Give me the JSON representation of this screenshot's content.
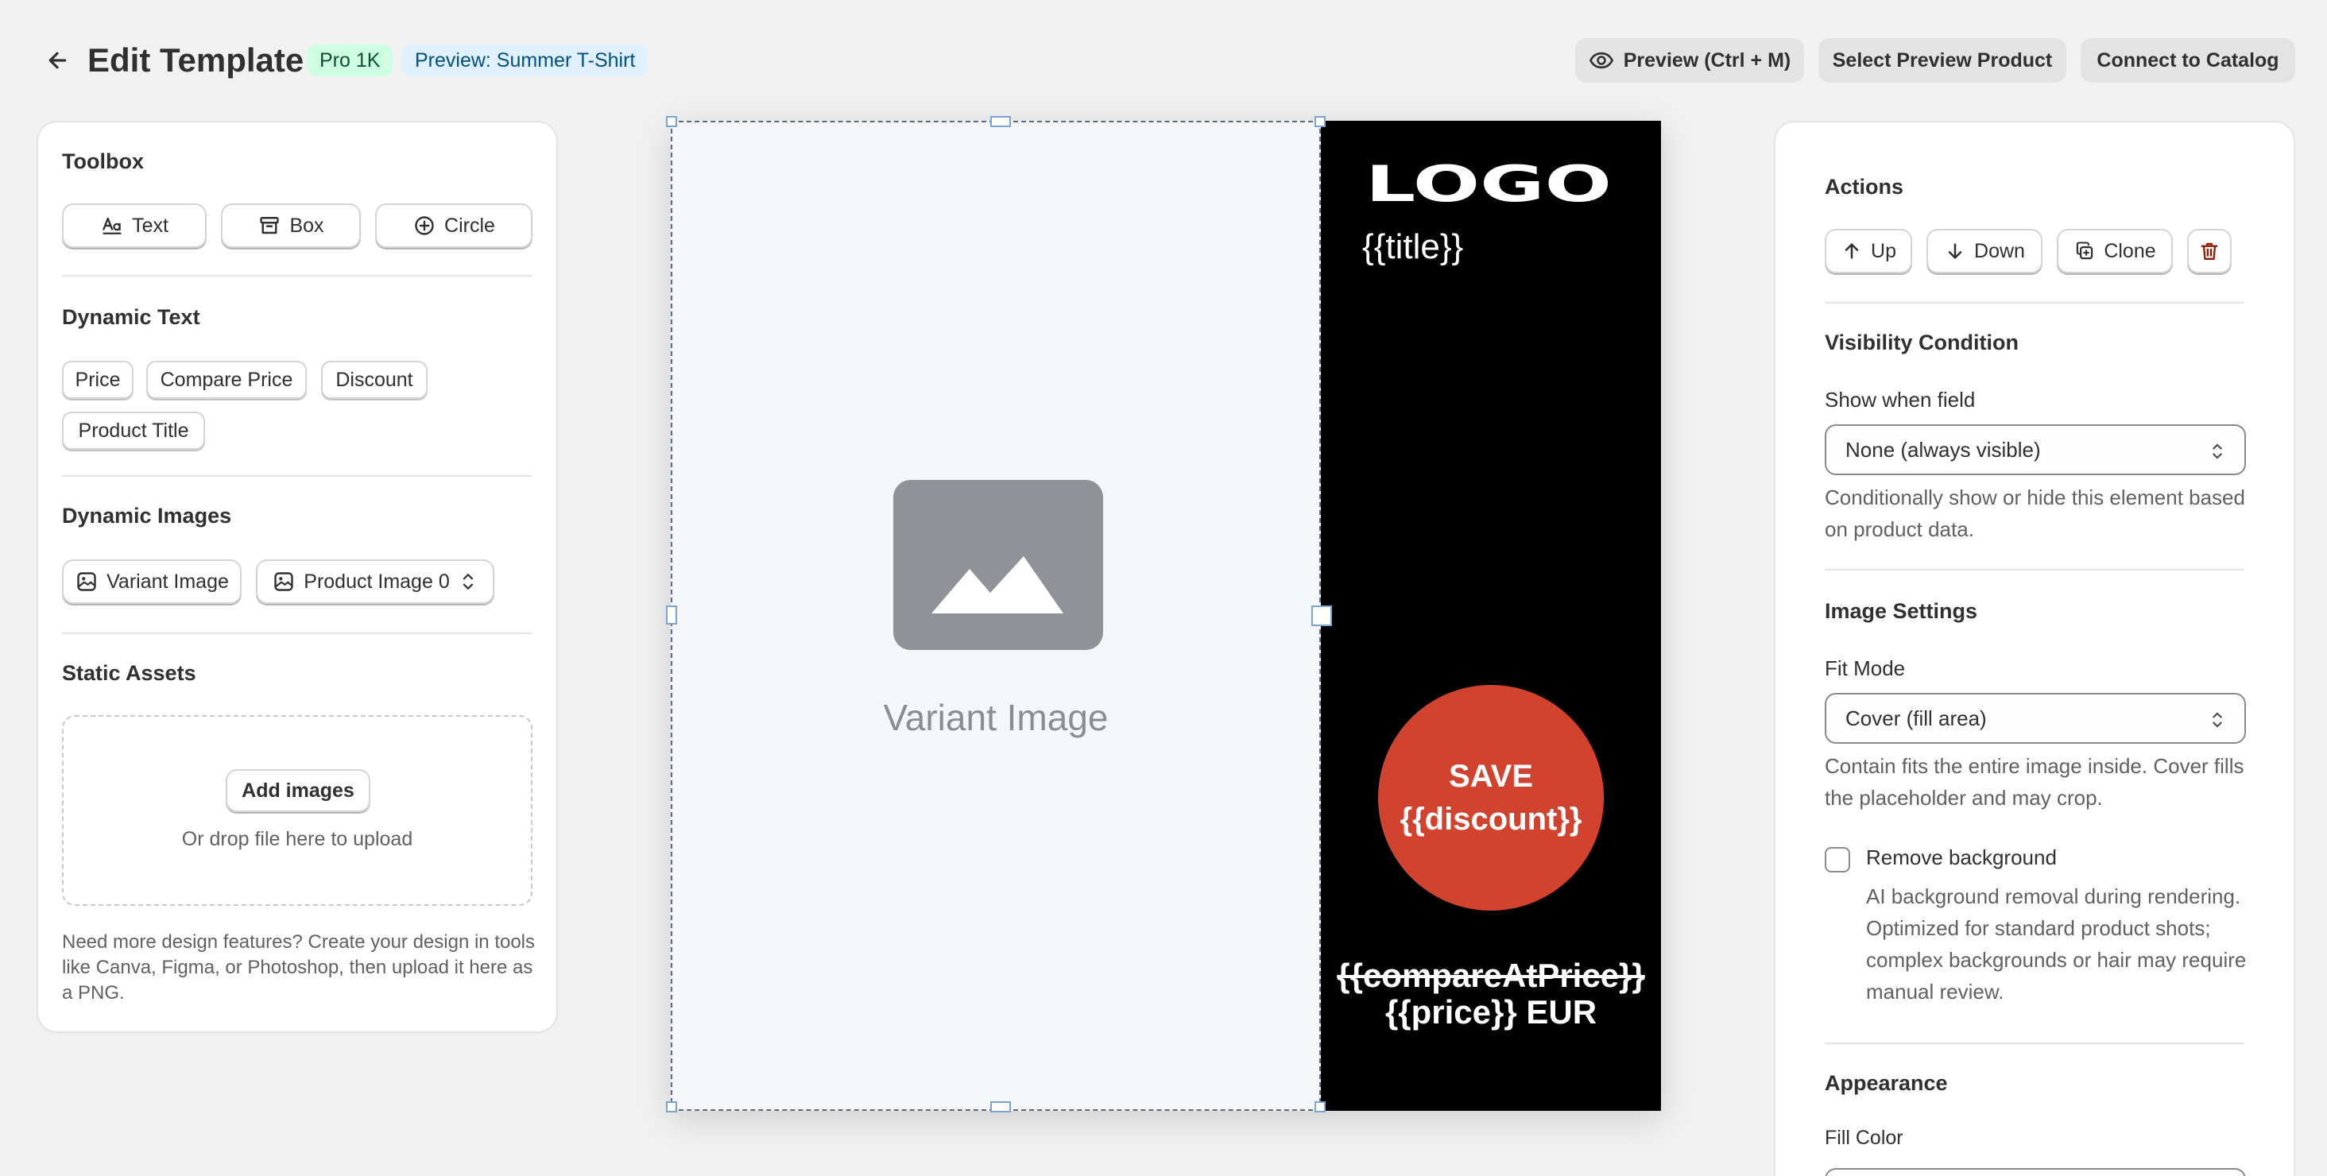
{
  "header": {
    "title": "Edit Template",
    "plan_badge": "Pro 1K",
    "preview_badge": "Preview: Summer T-Shirt",
    "preview_button": "Preview (Ctrl + M)",
    "select_preview_button": "Select Preview Product",
    "connect_button": "Connect to Catalog"
  },
  "toolbox": {
    "title": "Toolbox",
    "text_button": "Text",
    "box_button": "Box",
    "circle_button": "Circle"
  },
  "dynamic_text": {
    "title": "Dynamic Text",
    "chips": [
      "Price",
      "Compare Price",
      "Discount",
      "Product Title"
    ]
  },
  "dynamic_images": {
    "title": "Dynamic Images",
    "variant_button": "Variant Image",
    "product_image_select": "Product Image 0"
  },
  "static_assets": {
    "title": "Static Assets",
    "add_images_button": "Add images",
    "drop_hint": "Or drop file here to upload",
    "help_text": "Need more design features? Create your design in tools like Canva, Figma, or Photoshop, then upload it here as a PNG."
  },
  "canvas": {
    "variant_placeholder": "Variant Image",
    "logo_text": "LOGO",
    "title_placeholder": "{{title}}",
    "save_line1": "SAVE",
    "save_line2": "{{discount}}",
    "compare_price": "{{compareAtPrice}}",
    "price": "{{price}} EUR",
    "colors": {
      "background": "#000000",
      "badge": "#d1432e",
      "placeholder": "#f4f6f8"
    }
  },
  "actions": {
    "title": "Actions",
    "up_button": "Up",
    "down_button": "Down",
    "clone_button": "Clone"
  },
  "visibility": {
    "title": "Visibility Condition",
    "field_label": "Show when field",
    "select_value": "None (always visible)",
    "description": "Conditionally show or hide this element based on product data."
  },
  "image_settings": {
    "title": "Image Settings",
    "fit_label": "Fit Mode",
    "fit_value": "Cover (fill area)",
    "fit_description": "Contain fits the entire image inside. Cover fills the placeholder and may crop.",
    "remove_bg_label": "Remove background",
    "remove_bg_checked": false,
    "remove_bg_description": "AI background removal during rendering. Optimized for standard product shots; complex backgrounds or hair may require manual review."
  },
  "appearance": {
    "title": "Appearance",
    "fill_label": "Fill Color"
  }
}
